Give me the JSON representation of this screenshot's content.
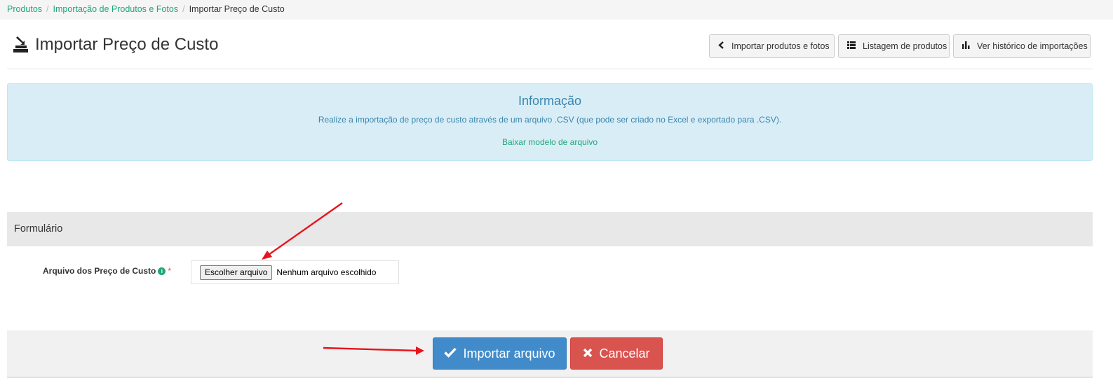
{
  "breadcrumb": {
    "items": [
      "Produtos",
      "Importação de Produtos e Fotos"
    ],
    "separator": "/",
    "current": "Importar Preço de Custo"
  },
  "header": {
    "title": "Importar Preço de Custo",
    "title_icon": "import-icon",
    "buttons": [
      {
        "label": "Importar produtos e fotos",
        "icon": "chevron-left-icon"
      },
      {
        "label": "Listagem de produtos",
        "icon": "list-icon"
      },
      {
        "label": "Ver histórico de importações",
        "icon": "bar-chart-icon"
      }
    ]
  },
  "info": {
    "title": "Informação",
    "text": "Realize a importação de preço de custo através de um arquivo .CSV (que pode ser criado no Excel e exportado para .CSV).",
    "link": "Baixar modelo de arquivo"
  },
  "form": {
    "heading": "Formulário",
    "field_label": "Arquivo dos Preço de Custo",
    "info_icon": "i",
    "required_mark": "*",
    "file_button": "Escolher arquivo",
    "file_status": "Nenhum arquivo escolhido"
  },
  "actions": {
    "submit": "Importar arquivo",
    "cancel": "Cancelar"
  },
  "colors": {
    "link": "#1fa67a",
    "primary": "#428bca",
    "danger": "#d9534f",
    "info_bg": "#d9edf7",
    "annotation_arrow": "#e8141c"
  }
}
